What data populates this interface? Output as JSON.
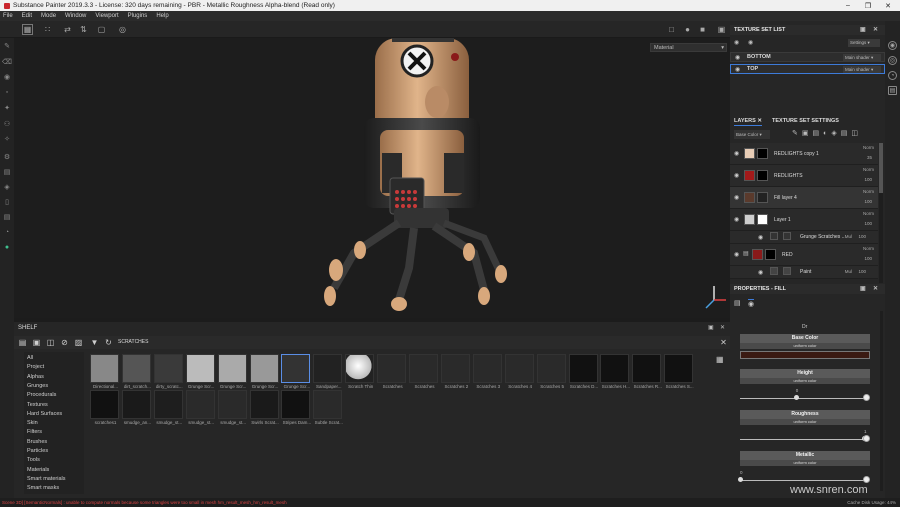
{
  "window": {
    "title": "Substance Painter 2019.3.3 - License: 320 days remaining - PBR - Metallic Roughness Alpha-blend (Read only)"
  },
  "menu": [
    "File",
    "Edit",
    "Mode",
    "Window",
    "Viewport",
    "Plugins",
    "Help"
  ],
  "viewport": {
    "material_select": "Material"
  },
  "texture_set_list": {
    "title": "TEXTURE SET LIST",
    "settings": "Settings",
    "sets": [
      {
        "name": "BOTTOM",
        "shader": "Main shader"
      },
      {
        "name": "TOP",
        "shader": "Main shader"
      }
    ]
  },
  "layers_panel": {
    "tab_layers": "LAYERS",
    "tab_settings": "TEXTURE SET SETTINGS",
    "channel": "Base Color",
    "layers": [
      {
        "name": "REDLIGHTS copy 1",
        "blend": "Norm",
        "opacity": "35",
        "swatch": "#e8cdb6",
        "mask": "#000000"
      },
      {
        "name": "REDLIGHTS",
        "blend": "Norm",
        "opacity": "100",
        "swatch": "#a31a1a",
        "mask": "#000000"
      },
      {
        "name": "Fill layer 4",
        "blend": "Norm",
        "opacity": "100",
        "swatch": "#5a3a2c",
        "mask": "#222222"
      },
      {
        "name": "Layer 1",
        "blend": "Norm",
        "opacity": "100",
        "swatch": "#cfcfcf",
        "mask": "#ffffff"
      },
      {
        "name": "Grunge Scratches ...",
        "blend": "Mul",
        "opacity": "100",
        "swatch": "#333333",
        "mask": "#333333"
      },
      {
        "name": "RED",
        "blend": "Norm",
        "opacity": "100",
        "swatch": "#8a1a1a",
        "mask": "#000000"
      },
      {
        "name": "Paint",
        "blend": "Mul",
        "opacity": "100",
        "swatch": "#444444",
        "mask": "#444444"
      }
    ]
  },
  "properties": {
    "title": "PROPERTIES - FILL",
    "group": "Dr",
    "base_color": {
      "label": "Base Color",
      "sub": "uniform color",
      "value": "#3a1a12"
    },
    "height": {
      "label": "Height",
      "sub": "uniform color",
      "value": "0",
      "level": 0.45
    },
    "roughness": {
      "label": "Roughness",
      "sub": "uniform color",
      "value": "1",
      "level": 1.0
    },
    "metallic": {
      "label": "Metallic",
      "sub": "uniform color",
      "value": "0",
      "level": 0.0
    }
  },
  "shelf": {
    "title": "SHELF",
    "search": "SCRATCHES",
    "categories": [
      "All",
      "Project",
      "Alphas",
      "Grunges",
      "Procedurals",
      "Textures",
      "Hard Surfaces",
      "Skin",
      "Filters",
      "Brushes",
      "Particles",
      "Tools",
      "Materials",
      "Smart materials",
      "Smart masks"
    ],
    "row1": [
      "Directional...",
      "dirt_scratch...",
      "dirty_scratc...",
      "Grunge Scr...",
      "Grunge Scr...",
      "Grunge Scr...",
      "Grunge Scr...",
      "Sandpaper...",
      "Scratch Thin",
      "Scratches",
      "Scratches",
      "Scratches 2",
      "Scratches 3",
      "Scratches 4",
      "Scratches 5",
      "Scratches D...",
      "Scratches H...",
      "Scratches R...",
      "Scratches S..."
    ],
    "row2": [
      "scratches1",
      "smudge_an...",
      "smudge_st...",
      "smudge_st...",
      "smudge_st...",
      "Swirls Scrat...",
      "Stripes Dam...",
      "Subtle Scrat..."
    ]
  },
  "status": {
    "message": "Scene 3D] [SemanticNormals] : unable to compute normals because some triangles were too small in mesh hm_result_mesh_hm_result_mesh",
    "right": "Cache Disk Usage:  44%"
  },
  "watermark": "www.snren.com",
  "colors": {
    "accent": "#3d7bd9",
    "status_error": "#d94343"
  }
}
